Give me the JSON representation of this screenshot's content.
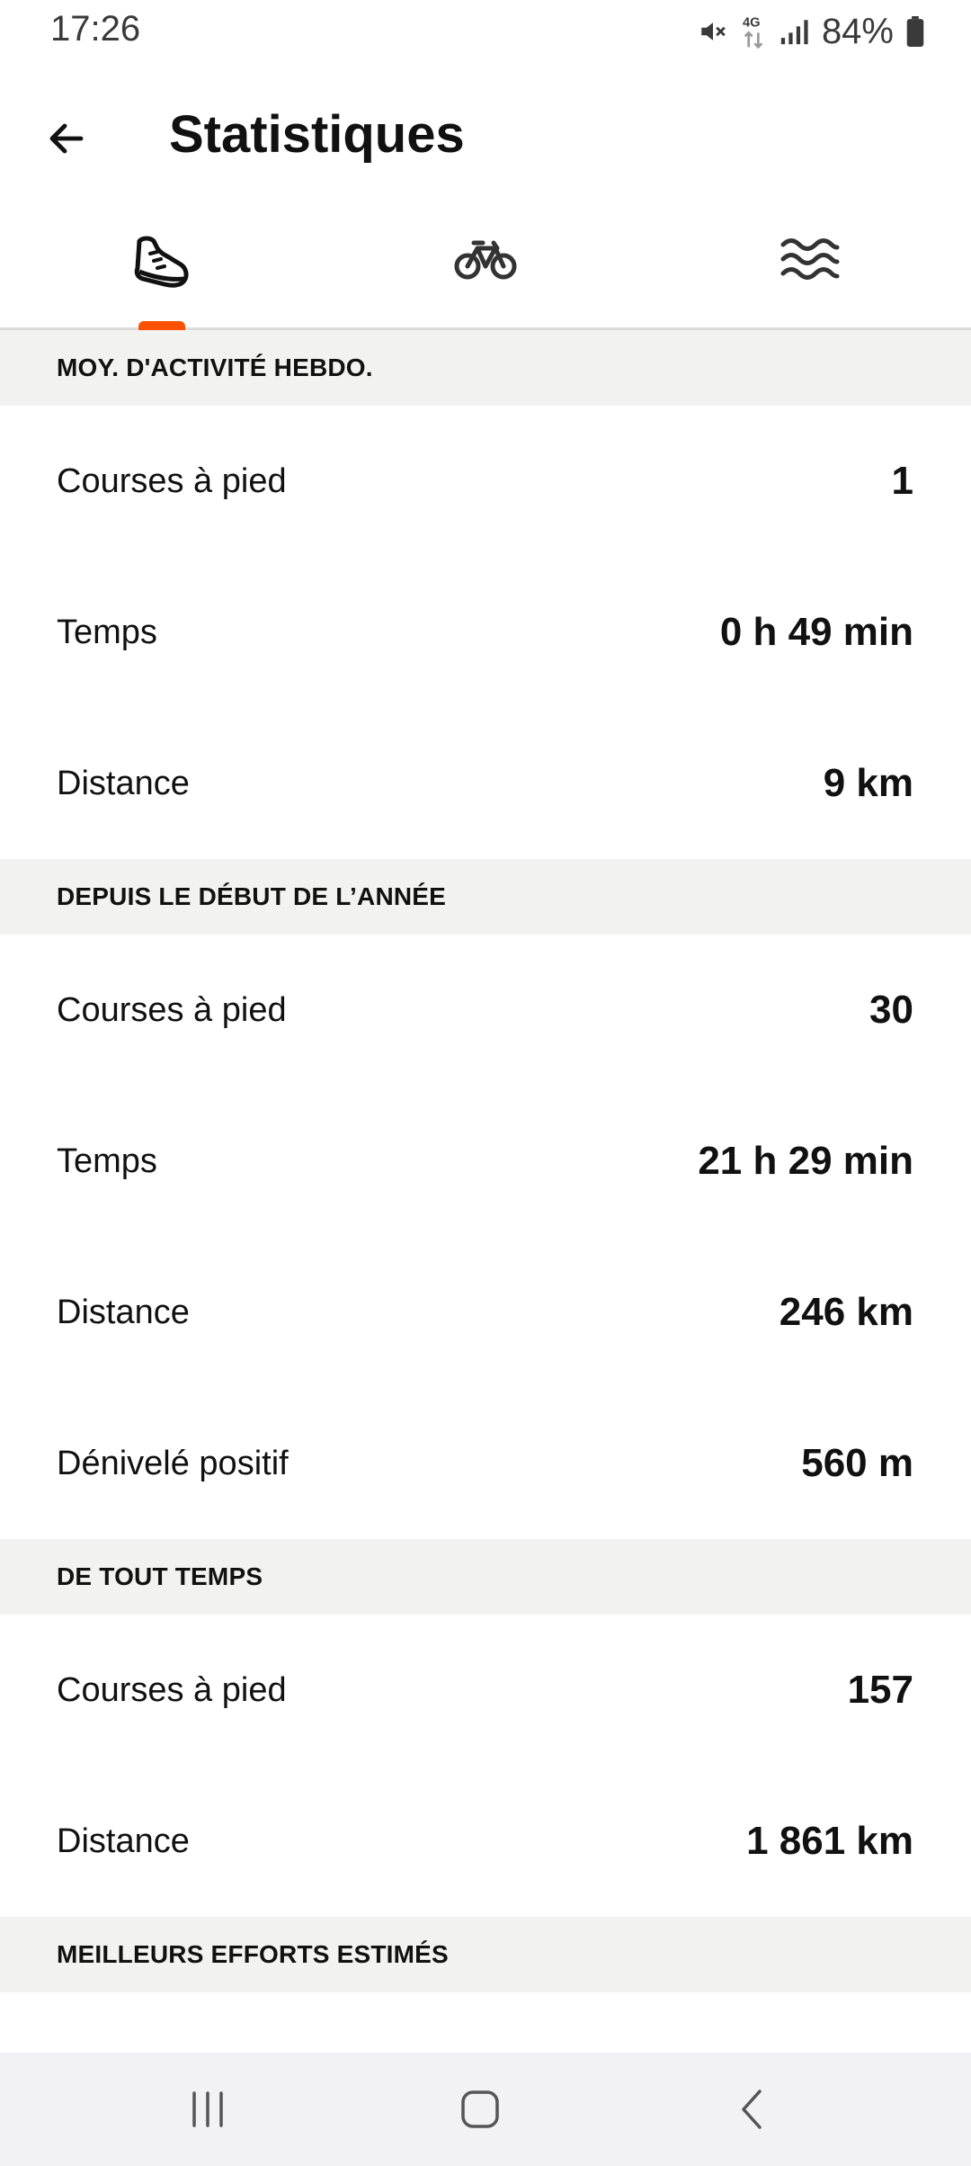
{
  "status_bar": {
    "time": "17:26",
    "network": "4G",
    "battery": "84%",
    "icons": [
      "mute-icon",
      "4g-data-icon",
      "signal-icon",
      "battery-icon"
    ]
  },
  "header": {
    "title": "Statistiques",
    "back_icon": "arrow-left-icon"
  },
  "tabs": [
    {
      "name": "run",
      "icon": "running-shoe-icon",
      "active": true
    },
    {
      "name": "ride",
      "icon": "bicycle-icon",
      "active": false
    },
    {
      "name": "swim",
      "icon": "waves-icon",
      "active": false
    }
  ],
  "colors": {
    "accent": "#fc5200",
    "section_bg": "#f2f2f1",
    "nav_bg": "#f2f2f4"
  },
  "sections": [
    {
      "title": "MOY. D'ACTIVITÉ HEBDO.",
      "rows": [
        {
          "label": "Courses à pied",
          "value": "1"
        },
        {
          "label": "Temps",
          "value": "0 h 49 min"
        },
        {
          "label": "Distance",
          "value": "9 km"
        }
      ]
    },
    {
      "title": "DEPUIS LE DÉBUT DE L’ANNÉE",
      "rows": [
        {
          "label": "Courses à pied",
          "value": "30"
        },
        {
          "label": "Temps",
          "value": "21 h 29 min"
        },
        {
          "label": "Distance",
          "value": "246 km"
        },
        {
          "label": "Dénivelé positif",
          "value": "560 m"
        }
      ]
    },
    {
      "title": "DE TOUT TEMPS",
      "rows": [
        {
          "label": "Courses à pied",
          "value": "157"
        },
        {
          "label": "Distance",
          "value": "1 861 km"
        }
      ]
    },
    {
      "title": "MEILLEURS EFFORTS ESTIMÉS",
      "rows": []
    }
  ],
  "nav_bar": {
    "buttons": [
      "recent-apps-icon",
      "home-icon",
      "back-icon"
    ]
  }
}
